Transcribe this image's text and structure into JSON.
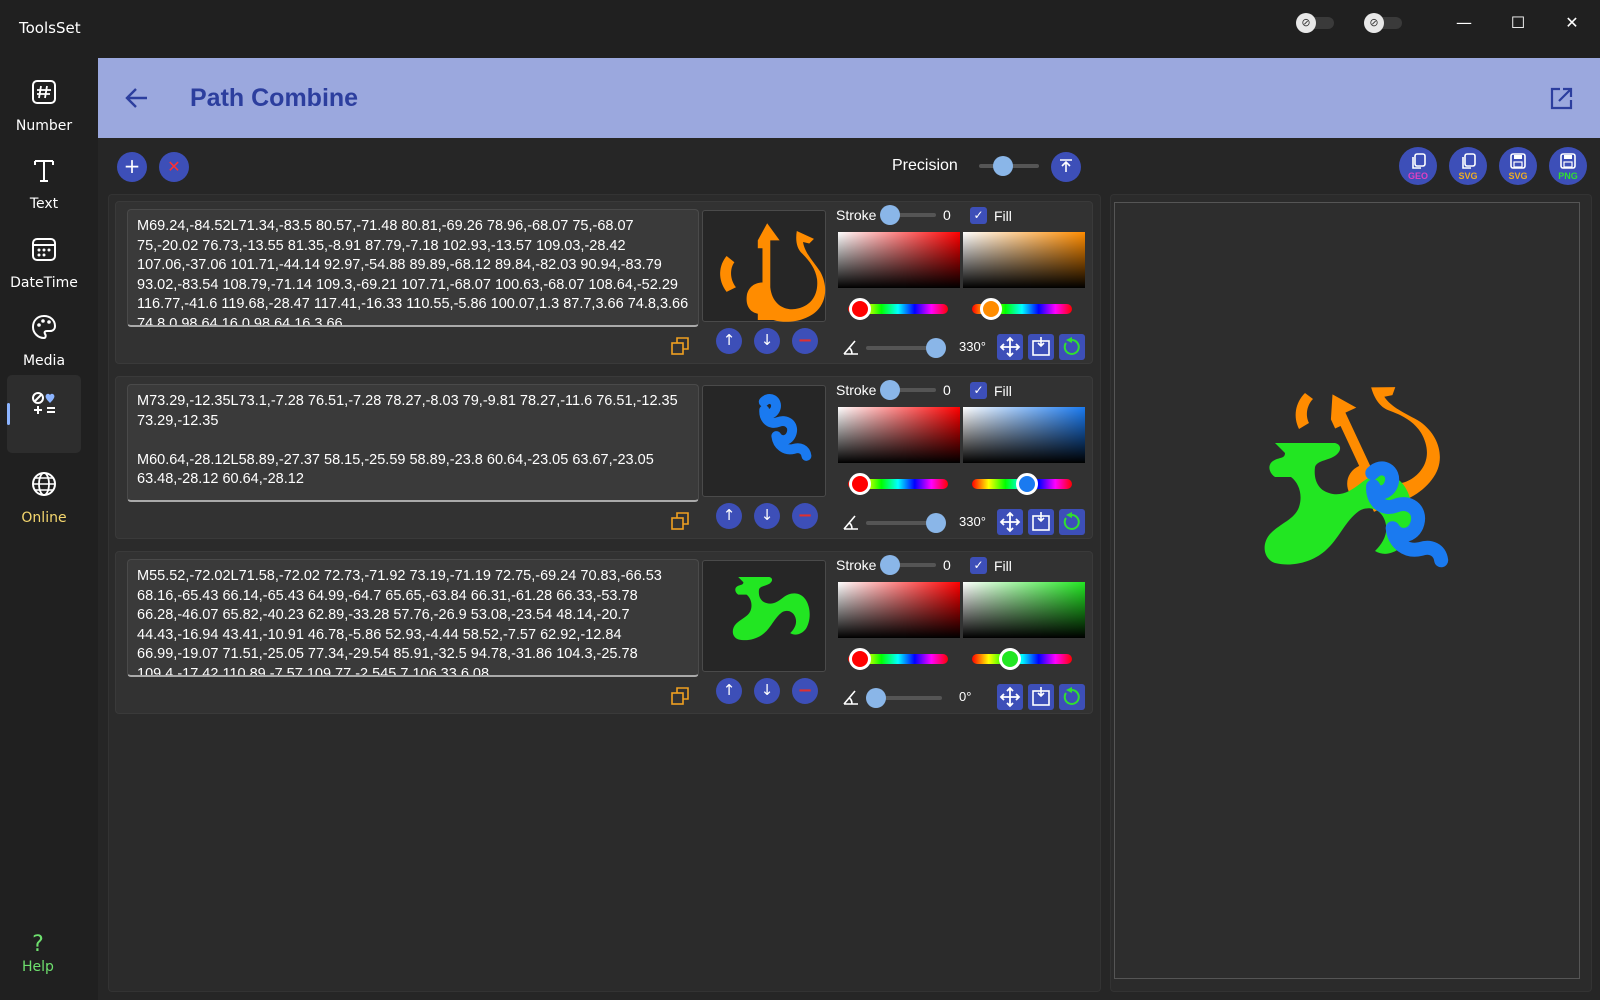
{
  "app": {
    "title": "ToolsSet"
  },
  "window": {
    "minimize": "—",
    "maximize": "☐",
    "close": "✕"
  },
  "sidebar": {
    "items": [
      {
        "label": "Number",
        "icon": "number-icon"
      },
      {
        "label": "Text",
        "icon": "text-icon"
      },
      {
        "label": "DateTime",
        "icon": "calendar-icon"
      },
      {
        "label": "Media",
        "icon": "palette-icon"
      },
      {
        "label": "",
        "icon": "shapes-icon",
        "active": true
      },
      {
        "label": "Online",
        "icon": "globe-icon"
      }
    ],
    "help": {
      "label": "Help",
      "glyph": "?"
    }
  },
  "header": {
    "title": "Path Combine",
    "back_icon": "arrow-left-icon",
    "open_icon": "open-external-icon"
  },
  "toolbar": {
    "add_glyph": "+",
    "clear_glyph": "✕",
    "precision_label": "Precision",
    "precision_value": 0.4,
    "exports": [
      {
        "tag": "GEO",
        "tag_color": "#e040c0",
        "icon": "copy-icon"
      },
      {
        "tag": "SVG",
        "tag_color": "#f0b020",
        "icon": "copy-icon"
      },
      {
        "tag": "SVG",
        "tag_color": "#f0b020",
        "icon": "save-icon"
      },
      {
        "tag": "PNG",
        "tag_color": "#30e030",
        "icon": "save-icon"
      }
    ]
  },
  "paths": [
    {
      "text": "M69.24,-84.52L71.34,-83.5 80.57,-71.48 80.81,-69.26 78.96,-68.07 75,-68.07 75,-20.02 76.73,-13.55 81.35,-8.91 87.79,-7.18 102.93,-13.57 109.03,-28.42 107.06,-37.06 101.71,-44.14 92.97,-54.88 89.89,-68.12 89.84,-82.03 90.94,-83.79 93.02,-83.54 108.79,-71.14 109.3,-69.21 107.71,-68.07 100.63,-68.07 108.64,-52.29 116.77,-41.6 119.68,-28.47 117.41,-16.33 110.55,-5.86 100.07,1.3 87.7,3.66 74.8,3.66 74.8,0.98 64.16,0.98 64.16,3.66",
      "color": "#ff8c00",
      "stroke_label": "Stroke",
      "stroke_value": "0",
      "fill_label": "Fill",
      "angle": "330°",
      "angle_value": 330,
      "hue_value": 0.08
    },
    {
      "text": "M73.29,-12.35L73.1,-7.28 76.51,-7.28 78.27,-8.03 79,-9.81 78.27,-11.6 76.51,-12.35 73.29,-12.35\n\nM60.64,-28.12L58.89,-27.37 58.15,-25.59 58.89,-23.8 60.64,-23.05 63.67,-23.05 63.48,-28.12 60.64,-28.12",
      "color": "#1a7af0",
      "stroke_label": "Stroke",
      "stroke_value": "0",
      "fill_label": "Fill",
      "angle": "330°",
      "angle_value": 330,
      "hue_value": 0.58
    },
    {
      "text": "M55.52,-72.02L71.58,-72.02 72.73,-71.92 73.19,-71.19 72.75,-69.24 70.83,-66.53 68.16,-65.43 66.14,-65.43 64.99,-64.7 65.65,-63.84 66.31,-61.28 66.33,-53.78 66.28,-46.07 65.82,-40.23 62.89,-33.28 57.76,-26.9 53.08,-23.54 48.14,-20.7 44.43,-16.94 43.41,-10.91 46.78,-5.86 52.93,-4.44 58.52,-7.57 62.92,-12.84 66.99,-19.07 71.51,-25.05 77.34,-29.54 85.91,-32.5 94.78,-31.86 104.3,-25.78 109.4,-17.42 110.89,-7.57 109.77,-2.545 7.106.33 6.08",
      "color": "#22e622",
      "stroke_label": "Stroke",
      "stroke_value": "0",
      "fill_label": "Fill",
      "angle": "0°",
      "angle_value": 0,
      "hue_value": 0.31
    }
  ],
  "colors": {
    "accent": "#3d4fb8",
    "header": "#9ba8de",
    "title": "#2c3e9e",
    "online": "#f5d76e",
    "help": "#6ee06e",
    "copy_icon": "#f0a020"
  }
}
